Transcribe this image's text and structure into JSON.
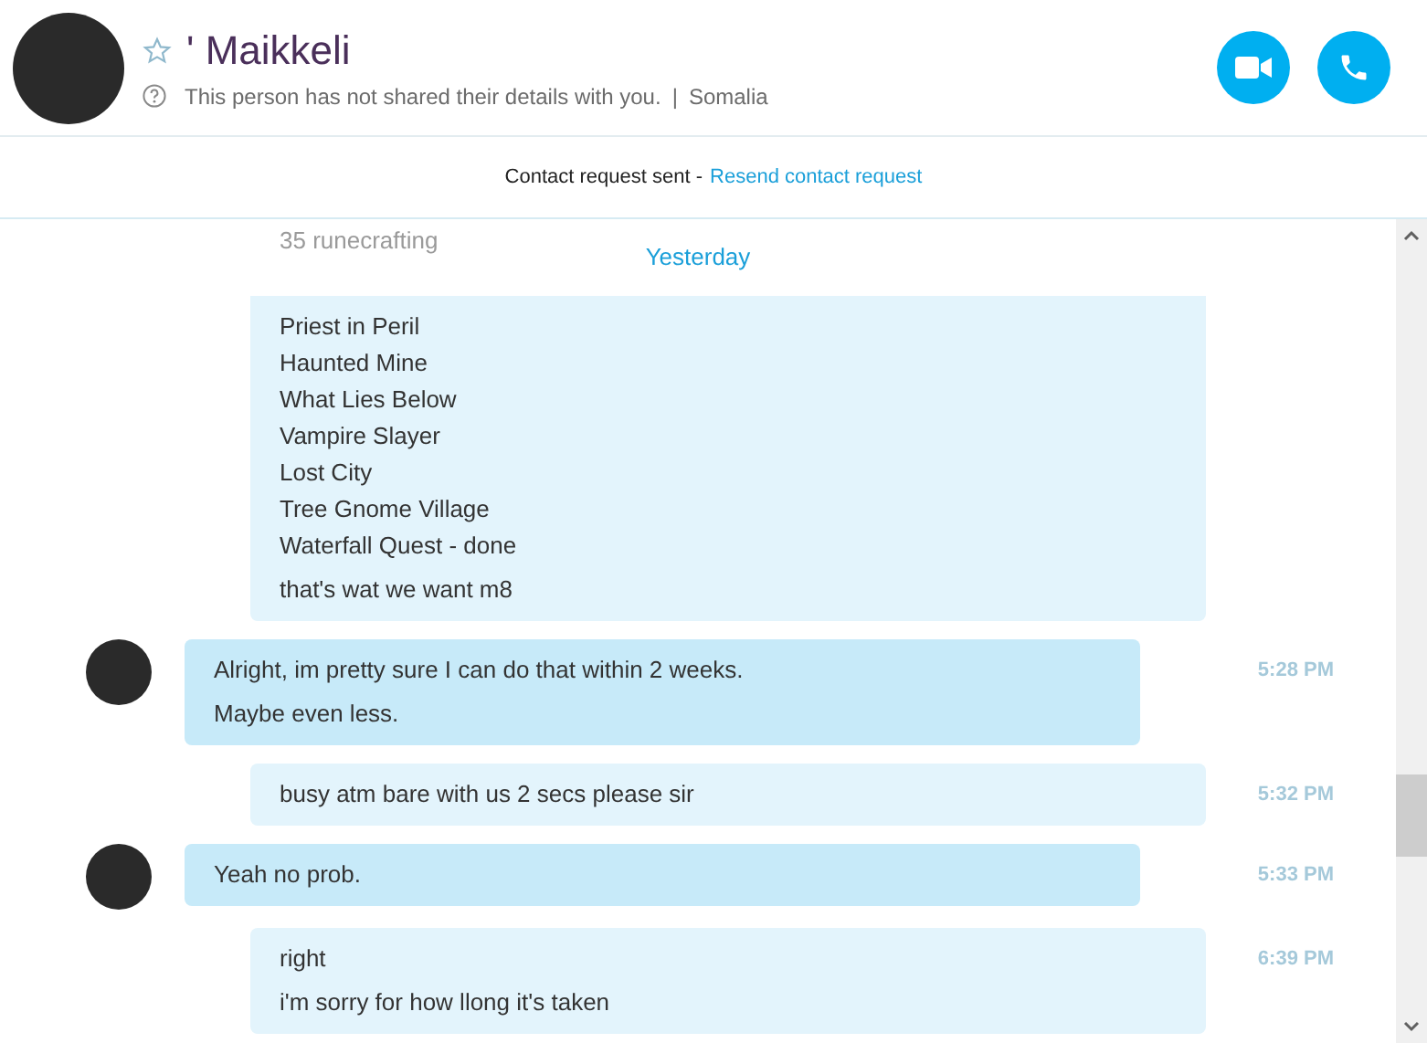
{
  "contact": {
    "name": "' Maikkeli",
    "favorite": false,
    "details": "This person has not shared their details with you.",
    "separator": "|",
    "location": "Somalia"
  },
  "calls": [
    {
      "kind": "video"
    },
    {
      "kind": "audio"
    }
  ],
  "request_bar": {
    "status": "Contact request sent -",
    "link": "Resend contact request"
  },
  "date_divider": "Yesterday",
  "messages": [
    {
      "kind": "outgoing",
      "faded_lines": [
        "35 runecrafting"
      ],
      "paragraphs": [
        [
          "Priest in Peril",
          "Haunted Mine",
          "What Lies Below",
          "Vampire Slayer",
          "Lost City",
          "Tree Gnome Village",
          "Waterfall Quest - done"
        ],
        [
          "that's wat we want m8"
        ]
      ]
    },
    {
      "kind": "incoming",
      "time": "5:28 PM",
      "paragraphs": [
        [
          "Alright, im pretty sure I can do that within 2 weeks."
        ],
        [
          "Maybe even less."
        ]
      ]
    },
    {
      "kind": "outgoing",
      "time": "5:32 PM",
      "paragraphs": [
        [
          "busy atm bare with us 2 secs please sir"
        ]
      ]
    },
    {
      "kind": "incoming",
      "time": "5:33 PM",
      "paragraphs": [
        [
          "Yeah no prob."
        ]
      ]
    },
    {
      "kind": "outgoing",
      "time": "6:39 PM",
      "paragraphs": [
        [
          "right"
        ],
        [
          "i'm sorry for how llong it's taken"
        ]
      ]
    }
  ]
}
